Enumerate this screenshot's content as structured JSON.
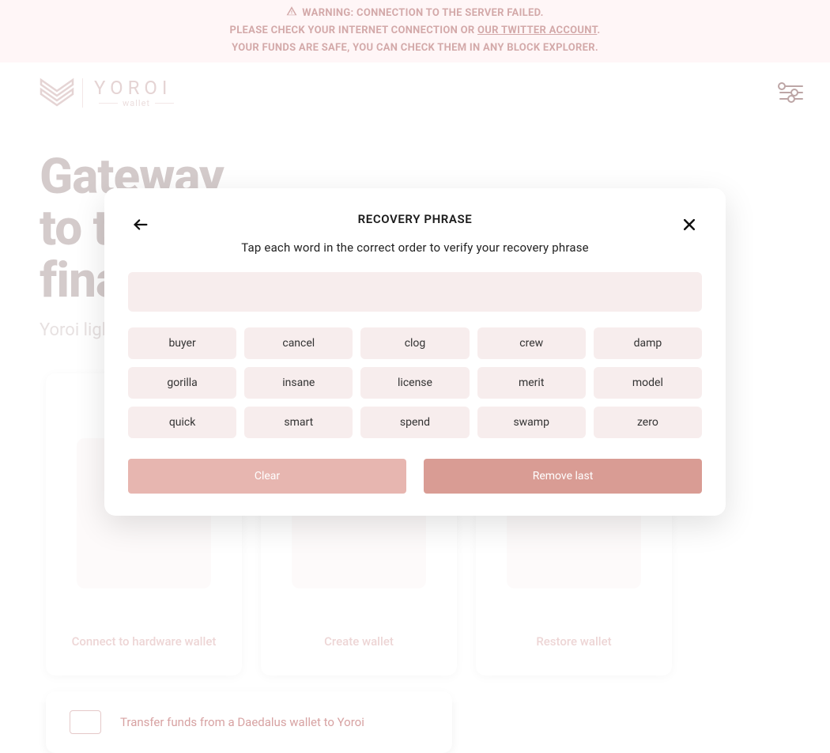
{
  "banner": {
    "line1_prefix": "WARNING: CONNECTION TO THE SERVER FAILED.",
    "line2_pre": "PLEASE CHECK YOUR INTERNET CONNECTION OR ",
    "line2_link": "OUR TWITTER ACCOUNT",
    "line2_post": ".",
    "line3": "YOUR FUNDS ARE SAFE, YOU CAN CHECK THEM IN ANY BLOCK EXPLORER."
  },
  "logo": {
    "brand": "YOROI",
    "sub": "wallet"
  },
  "hero": {
    "title_line1": "Gateway",
    "title_line2": "to the",
    "title_line3": "financial world",
    "tagline": "Yoroi light wallet for Cardano"
  },
  "cards": {
    "hardware": "Connect to hardware wallet",
    "create": "Create wallet",
    "restore": "Restore wallet",
    "transfer": "Transfer funds from a Daedalus wallet to Yoroi"
  },
  "modal": {
    "title": "RECOVERY PHRASE",
    "instruction": "Tap each word in the correct order to verify your recovery phrase",
    "words": [
      "buyer",
      "cancel",
      "clog",
      "crew",
      "damp",
      "gorilla",
      "insane",
      "license",
      "merit",
      "model",
      "quick",
      "smart",
      "spend",
      "swamp",
      "zero"
    ],
    "clear": "Clear",
    "remove": "Remove last"
  }
}
